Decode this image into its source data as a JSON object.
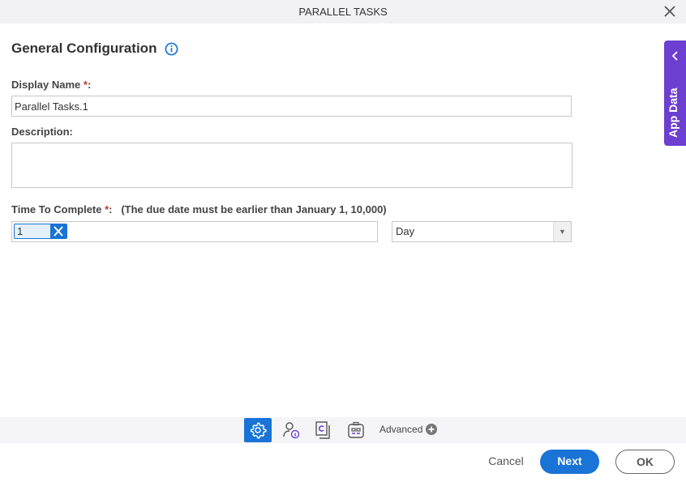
{
  "window": {
    "title": "PARALLEL TASKS"
  },
  "heading": "General Configuration",
  "form": {
    "display_name": {
      "label": "Display Name ",
      "required": "*",
      "suffix": ":",
      "value": "Parallel Tasks.1"
    },
    "description": {
      "label": "Description:",
      "value": ""
    },
    "time_to_complete": {
      "label": "Time To Complete ",
      "required": "*",
      "suffix": ":",
      "hint": "(The due date must be earlier than January 1, 10,000)",
      "value": "1",
      "unit": "Day"
    }
  },
  "app_data_tab": {
    "label": "App Data"
  },
  "toolbar": {
    "advanced_label": "Advanced",
    "icons": [
      "gear-icon",
      "user-info-icon",
      "refresh-document-icon",
      "badge-icon"
    ]
  },
  "footer": {
    "cancel": "Cancel",
    "next": "Next",
    "ok": "OK"
  },
  "colors": {
    "primary": "#1a73d6",
    "app_data": "#6c3fd0"
  }
}
